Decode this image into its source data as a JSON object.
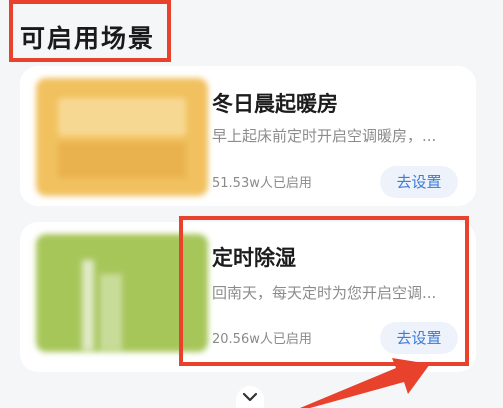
{
  "section": {
    "title": "可启用场景"
  },
  "scenes": [
    {
      "title": "冬日晨起暖房",
      "description": "早上起床前定时开启空调暖房，...",
      "count": "51.53w人已启用",
      "button": "去设置"
    },
    {
      "title": "定时除湿",
      "description": "回南天，每天定时为您开启空调...",
      "count": "20.56w人已启用",
      "button": "去设置"
    }
  ],
  "icons": {
    "expand": "chevron-down-icon"
  },
  "colors": {
    "annotation": "#e8412c",
    "button_text": "#3a7cd8",
    "button_bg": "#eef3fb"
  }
}
